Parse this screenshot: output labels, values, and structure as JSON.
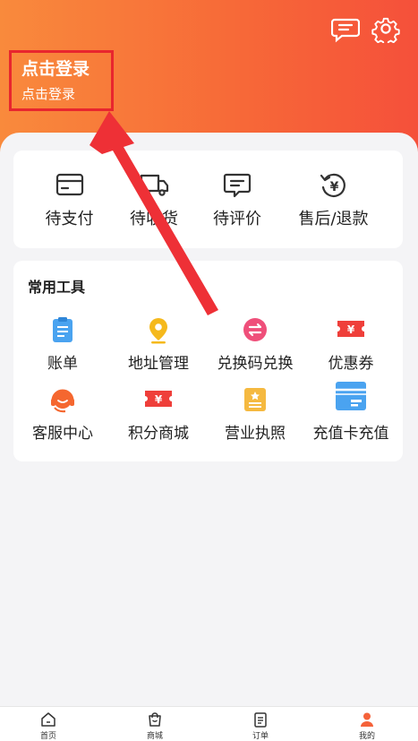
{
  "header": {
    "login_title": "点击登录",
    "login_subtitle": "点击登录",
    "message_icon": "chat-bubble-icon",
    "settings_icon": "gear-icon"
  },
  "orders": [
    {
      "label": "待支付",
      "icon": "card-icon"
    },
    {
      "label": "待收货",
      "icon": "truck-icon"
    },
    {
      "label": "待评价",
      "icon": "comment-icon"
    },
    {
      "label": "售后/退款",
      "icon": "refund-icon"
    }
  ],
  "tools": {
    "title": "常用工具",
    "items": [
      {
        "label": "账单",
        "icon": "bill-icon"
      },
      {
        "label": "地址管理",
        "icon": "location-pin-icon"
      },
      {
        "label": "兑换码兑换",
        "icon": "exchange-icon"
      },
      {
        "label": "优惠券",
        "icon": "coupon-icon"
      },
      {
        "label": "客服中心",
        "icon": "headset-icon"
      },
      {
        "label": "积分商城",
        "icon": "points-ticket-icon"
      },
      {
        "label": "营业执照",
        "icon": "license-icon"
      },
      {
        "label": "充值卡充值",
        "icon": "recharge-card-icon"
      }
    ]
  },
  "tabbar": [
    {
      "label": "首页",
      "icon": "home-icon"
    },
    {
      "label": "商城",
      "icon": "shopping-bag-icon"
    },
    {
      "label": "订单",
      "icon": "order-list-icon"
    },
    {
      "label": "我的",
      "icon": "user-icon",
      "active": true
    }
  ],
  "colors": {
    "header_start": "#f98a3c",
    "header_end": "#f5503a",
    "highlight_box": "#e8262e",
    "annotation_arrow": "#ee3036",
    "active_tab": "#f5623a"
  }
}
